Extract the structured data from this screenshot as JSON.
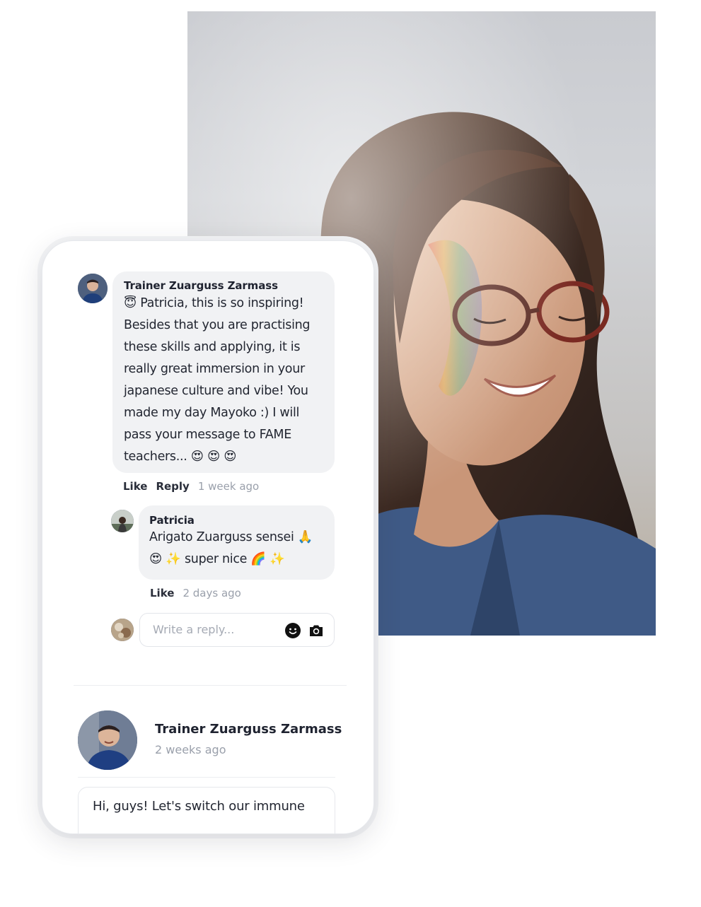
{
  "comment": {
    "author": "Trainer Zuarguss Zarmass",
    "lines": [
      "😇 Patricia, this is so inspiring!",
      "Besides that you are practising",
      "these skills and applying, it is",
      "really great immersion in your",
      "japanese culture and vibe! You",
      "made my day Mayoko :) I will",
      "pass your message to FAME",
      "teachers... 😍 😍 😍"
    ],
    "like_label": "Like",
    "reply_label": "Reply",
    "time": "1 week ago"
  },
  "reply": {
    "author": "Patricia",
    "lines": [
      "Arigato Zuarguss sensei 🙏",
      "😍 ✨ super nice 🌈 ✨"
    ],
    "like_label": "Like",
    "time": "2 days ago"
  },
  "reply_input": {
    "placeholder": "Write a reply...",
    "emoji_icon": "smiley-icon",
    "camera_icon": "camera-icon"
  },
  "post": {
    "author": "Trainer Zuarguss Zarmass",
    "time": "2 weeks ago",
    "text": "Hi, guys! Let's switch our immune"
  },
  "colors": {
    "bubble": "#f1f2f4",
    "muted": "#9aa0ab",
    "text": "#222631"
  }
}
